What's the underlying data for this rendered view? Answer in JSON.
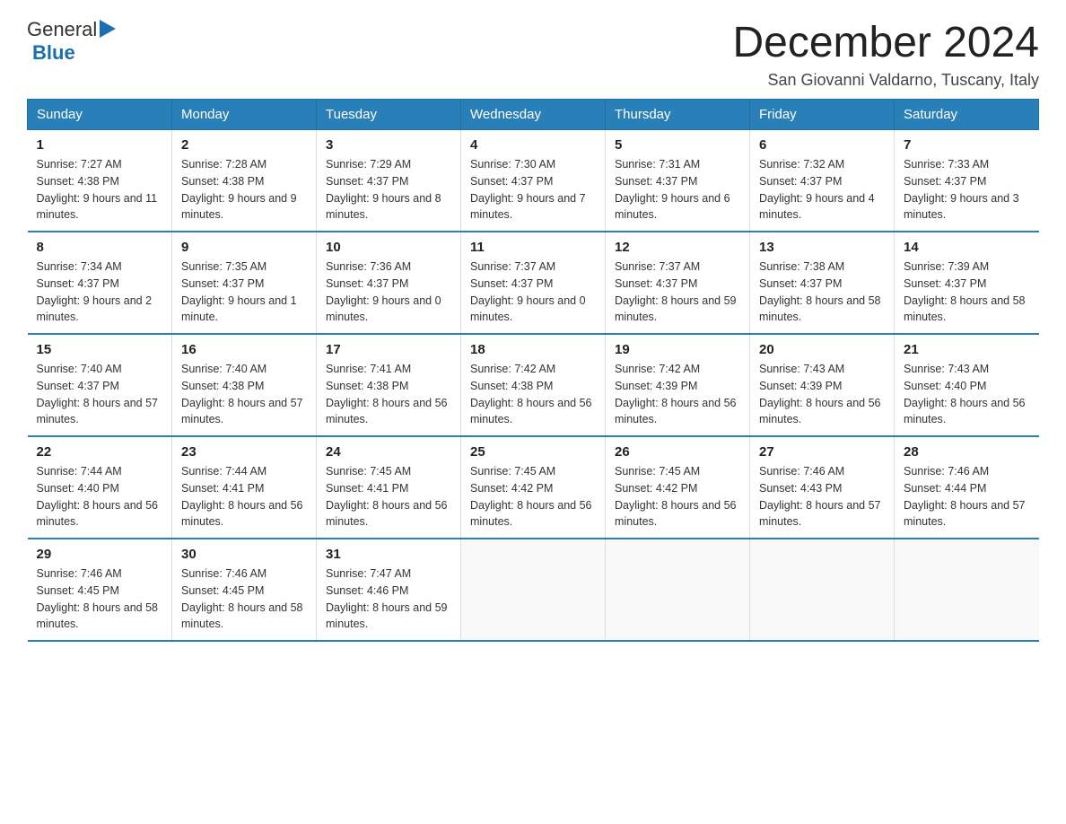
{
  "header": {
    "logo_general": "General",
    "logo_blue": "Blue",
    "month_title": "December 2024",
    "location": "San Giovanni Valdarno, Tuscany, Italy"
  },
  "days_of_week": [
    "Sunday",
    "Monday",
    "Tuesday",
    "Wednesday",
    "Thursday",
    "Friday",
    "Saturday"
  ],
  "weeks": [
    [
      {
        "day": "1",
        "sunrise": "7:27 AM",
        "sunset": "4:38 PM",
        "daylight": "9 hours and 11 minutes."
      },
      {
        "day": "2",
        "sunrise": "7:28 AM",
        "sunset": "4:38 PM",
        "daylight": "9 hours and 9 minutes."
      },
      {
        "day": "3",
        "sunrise": "7:29 AM",
        "sunset": "4:37 PM",
        "daylight": "9 hours and 8 minutes."
      },
      {
        "day": "4",
        "sunrise": "7:30 AM",
        "sunset": "4:37 PM",
        "daylight": "9 hours and 7 minutes."
      },
      {
        "day": "5",
        "sunrise": "7:31 AM",
        "sunset": "4:37 PM",
        "daylight": "9 hours and 6 minutes."
      },
      {
        "day": "6",
        "sunrise": "7:32 AM",
        "sunset": "4:37 PM",
        "daylight": "9 hours and 4 minutes."
      },
      {
        "day": "7",
        "sunrise": "7:33 AM",
        "sunset": "4:37 PM",
        "daylight": "9 hours and 3 minutes."
      }
    ],
    [
      {
        "day": "8",
        "sunrise": "7:34 AM",
        "sunset": "4:37 PM",
        "daylight": "9 hours and 2 minutes."
      },
      {
        "day": "9",
        "sunrise": "7:35 AM",
        "sunset": "4:37 PM",
        "daylight": "9 hours and 1 minute."
      },
      {
        "day": "10",
        "sunrise": "7:36 AM",
        "sunset": "4:37 PM",
        "daylight": "9 hours and 0 minutes."
      },
      {
        "day": "11",
        "sunrise": "7:37 AM",
        "sunset": "4:37 PM",
        "daylight": "9 hours and 0 minutes."
      },
      {
        "day": "12",
        "sunrise": "7:37 AM",
        "sunset": "4:37 PM",
        "daylight": "8 hours and 59 minutes."
      },
      {
        "day": "13",
        "sunrise": "7:38 AM",
        "sunset": "4:37 PM",
        "daylight": "8 hours and 58 minutes."
      },
      {
        "day": "14",
        "sunrise": "7:39 AM",
        "sunset": "4:37 PM",
        "daylight": "8 hours and 58 minutes."
      }
    ],
    [
      {
        "day": "15",
        "sunrise": "7:40 AM",
        "sunset": "4:37 PM",
        "daylight": "8 hours and 57 minutes."
      },
      {
        "day": "16",
        "sunrise": "7:40 AM",
        "sunset": "4:38 PM",
        "daylight": "8 hours and 57 minutes."
      },
      {
        "day": "17",
        "sunrise": "7:41 AM",
        "sunset": "4:38 PM",
        "daylight": "8 hours and 56 minutes."
      },
      {
        "day": "18",
        "sunrise": "7:42 AM",
        "sunset": "4:38 PM",
        "daylight": "8 hours and 56 minutes."
      },
      {
        "day": "19",
        "sunrise": "7:42 AM",
        "sunset": "4:39 PM",
        "daylight": "8 hours and 56 minutes."
      },
      {
        "day": "20",
        "sunrise": "7:43 AM",
        "sunset": "4:39 PM",
        "daylight": "8 hours and 56 minutes."
      },
      {
        "day": "21",
        "sunrise": "7:43 AM",
        "sunset": "4:40 PM",
        "daylight": "8 hours and 56 minutes."
      }
    ],
    [
      {
        "day": "22",
        "sunrise": "7:44 AM",
        "sunset": "4:40 PM",
        "daylight": "8 hours and 56 minutes."
      },
      {
        "day": "23",
        "sunrise": "7:44 AM",
        "sunset": "4:41 PM",
        "daylight": "8 hours and 56 minutes."
      },
      {
        "day": "24",
        "sunrise": "7:45 AM",
        "sunset": "4:41 PM",
        "daylight": "8 hours and 56 minutes."
      },
      {
        "day": "25",
        "sunrise": "7:45 AM",
        "sunset": "4:42 PM",
        "daylight": "8 hours and 56 minutes."
      },
      {
        "day": "26",
        "sunrise": "7:45 AM",
        "sunset": "4:42 PM",
        "daylight": "8 hours and 56 minutes."
      },
      {
        "day": "27",
        "sunrise": "7:46 AM",
        "sunset": "4:43 PM",
        "daylight": "8 hours and 57 minutes."
      },
      {
        "day": "28",
        "sunrise": "7:46 AM",
        "sunset": "4:44 PM",
        "daylight": "8 hours and 57 minutes."
      }
    ],
    [
      {
        "day": "29",
        "sunrise": "7:46 AM",
        "sunset": "4:45 PM",
        "daylight": "8 hours and 58 minutes."
      },
      {
        "day": "30",
        "sunrise": "7:46 AM",
        "sunset": "4:45 PM",
        "daylight": "8 hours and 58 minutes."
      },
      {
        "day": "31",
        "sunrise": "7:47 AM",
        "sunset": "4:46 PM",
        "daylight": "8 hours and 59 minutes."
      },
      null,
      null,
      null,
      null
    ]
  ]
}
